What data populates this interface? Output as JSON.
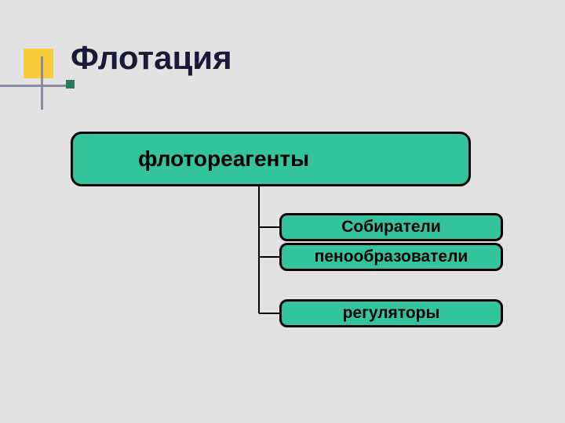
{
  "title": "Флотация",
  "diagram": {
    "root": "флотореагенты",
    "children": [
      "Собиратели",
      "пенообразователи",
      "регуляторы"
    ]
  },
  "colors": {
    "node_fill": "#33c49d",
    "accent_yellow": "#f8cd3c",
    "line": "#8a8aa0",
    "small_square": "#267a5e"
  }
}
